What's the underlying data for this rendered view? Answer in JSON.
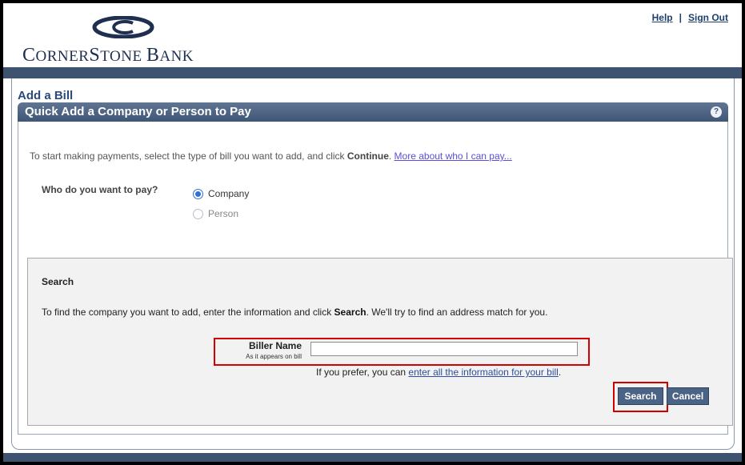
{
  "header": {
    "brand_name_first": "C",
    "brand_name_rest": "ORNER",
    "brand_name_s": "S",
    "brand_name_tone": "TONE ",
    "brand_name_b": "B",
    "brand_name_ank": "ANK",
    "links": {
      "help": "Help",
      "separator": "|",
      "sign_out": "Sign Out"
    }
  },
  "page_title": "Add a Bill",
  "section": {
    "title": "Quick Add a Company or Person to Pay",
    "help_icon": "?"
  },
  "intro": {
    "text_before": "To start making payments, select the type of bill you want to add, and click ",
    "bold": "Continue",
    "text_after": ". ",
    "link": "More about who I can pay..."
  },
  "who": {
    "label": "Who do you want to pay?",
    "options": [
      {
        "label": "Company",
        "checked": true
      },
      {
        "label": "Person",
        "checked": false
      }
    ]
  },
  "search": {
    "heading": "Search",
    "desc_before": "To find the company you want to add, enter the information and click ",
    "desc_bold": "Search",
    "desc_after": ". We'll try to find an address match for you.",
    "biller_label": "Biller Name",
    "biller_sublabel": "As it appears on bill",
    "biller_value": "",
    "prefer_before": "If you prefer, you can ",
    "prefer_link": "enter all the information for your bill",
    "prefer_after": ".",
    "search_button": "Search",
    "cancel_button": "Cancel"
  },
  "colors": {
    "brand_navy": "#1f2f4f",
    "band": "#3d5370",
    "highlight_red": "#d40000",
    "button_bg": "#4b6384"
  }
}
